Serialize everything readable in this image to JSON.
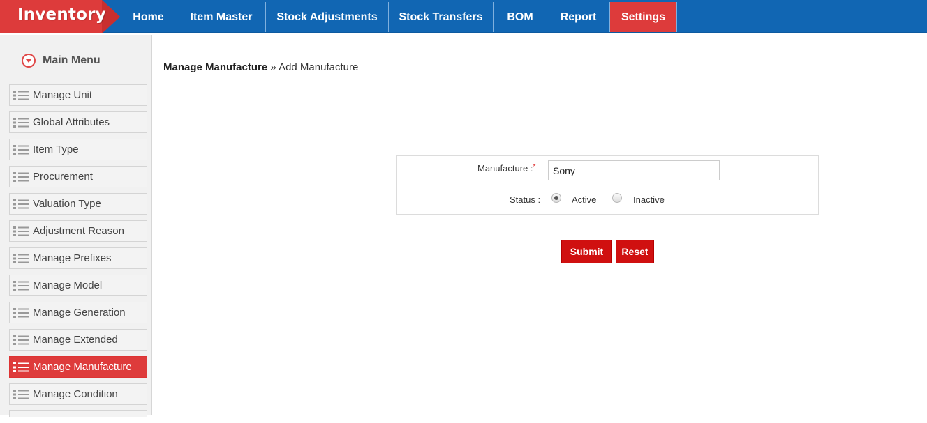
{
  "app": {
    "title": "Inventory"
  },
  "nav": {
    "items": [
      {
        "label": "Home"
      },
      {
        "label": "Item Master"
      },
      {
        "label": "Stock Adjustments"
      },
      {
        "label": "Stock Transfers"
      },
      {
        "label": "BOM"
      },
      {
        "label": "Report"
      },
      {
        "label": "Settings",
        "active": true
      }
    ]
  },
  "sidebar": {
    "heading": "Main Menu",
    "items": [
      {
        "label": "Manage Unit"
      },
      {
        "label": "Global Attributes"
      },
      {
        "label": "Item Type"
      },
      {
        "label": "Procurement"
      },
      {
        "label": "Valuation Type"
      },
      {
        "label": "Adjustment Reason"
      },
      {
        "label": "Manage Prefixes"
      },
      {
        "label": "Manage Model"
      },
      {
        "label": "Manage Generation"
      },
      {
        "label": "Manage Extended"
      },
      {
        "label": "Manage Manufacture",
        "active": true
      },
      {
        "label": "Manage Condition"
      }
    ]
  },
  "breadcrumb": {
    "parent": "Manage Manufacture",
    "separator": "»",
    "current": "Add Manufacture"
  },
  "form": {
    "manufacture_label": "Manufacture :",
    "required_mark": "*",
    "manufacture_value": "Sony",
    "status_label": "Status :",
    "status_options": [
      {
        "label": "Active",
        "selected": true
      },
      {
        "label": "Inactive",
        "selected": false
      }
    ]
  },
  "buttons": {
    "submit": "Submit",
    "reset": "Reset"
  },
  "colors": {
    "nav_blue": "#1166b3",
    "accent_red": "#de3b3b",
    "button_red": "#d01010"
  }
}
